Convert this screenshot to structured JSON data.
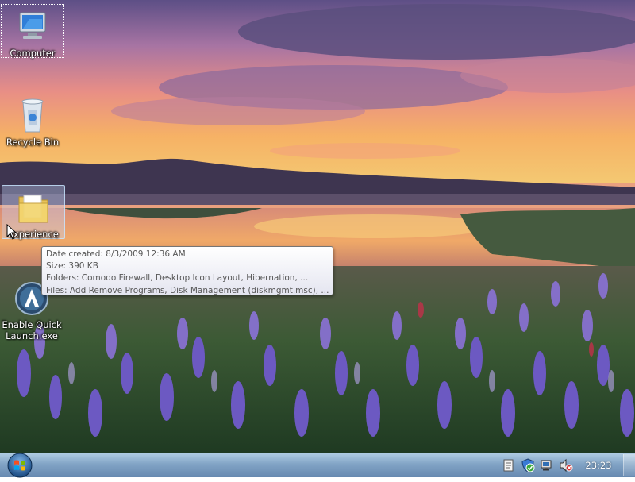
{
  "desktop": {
    "icons": [
      {
        "label": "Computer",
        "icon": "computer-icon"
      },
      {
        "label": "Recycle Bin",
        "icon": "recycle-bin-icon"
      },
      {
        "label": "experience",
        "icon": "folder-icon"
      },
      {
        "label_line1": "Enable Quick",
        "label_line2": "Launch.exe",
        "icon": "app-launcher-icon"
      }
    ]
  },
  "tooltip": {
    "date_created": "Date created: 8/3/2009 12:36 AM",
    "size": "Size: 390 KB",
    "folders": "Folders: Comodo Firewall, Desktop Icon Layout, Hibernation, ...",
    "files": "Files: Add Remove Programs, Disk Management (diskmgmt.msc), ..."
  },
  "taskbar": {
    "start_icon": "windows-orb-icon",
    "tray_icons": [
      "action-center-icon",
      "security-shield-icon",
      "network-icon",
      "volume-muted-icon"
    ],
    "clock": "23:23"
  },
  "colors": {
    "taskbar": "#7da0c3",
    "tooltip_text": "#575757"
  }
}
